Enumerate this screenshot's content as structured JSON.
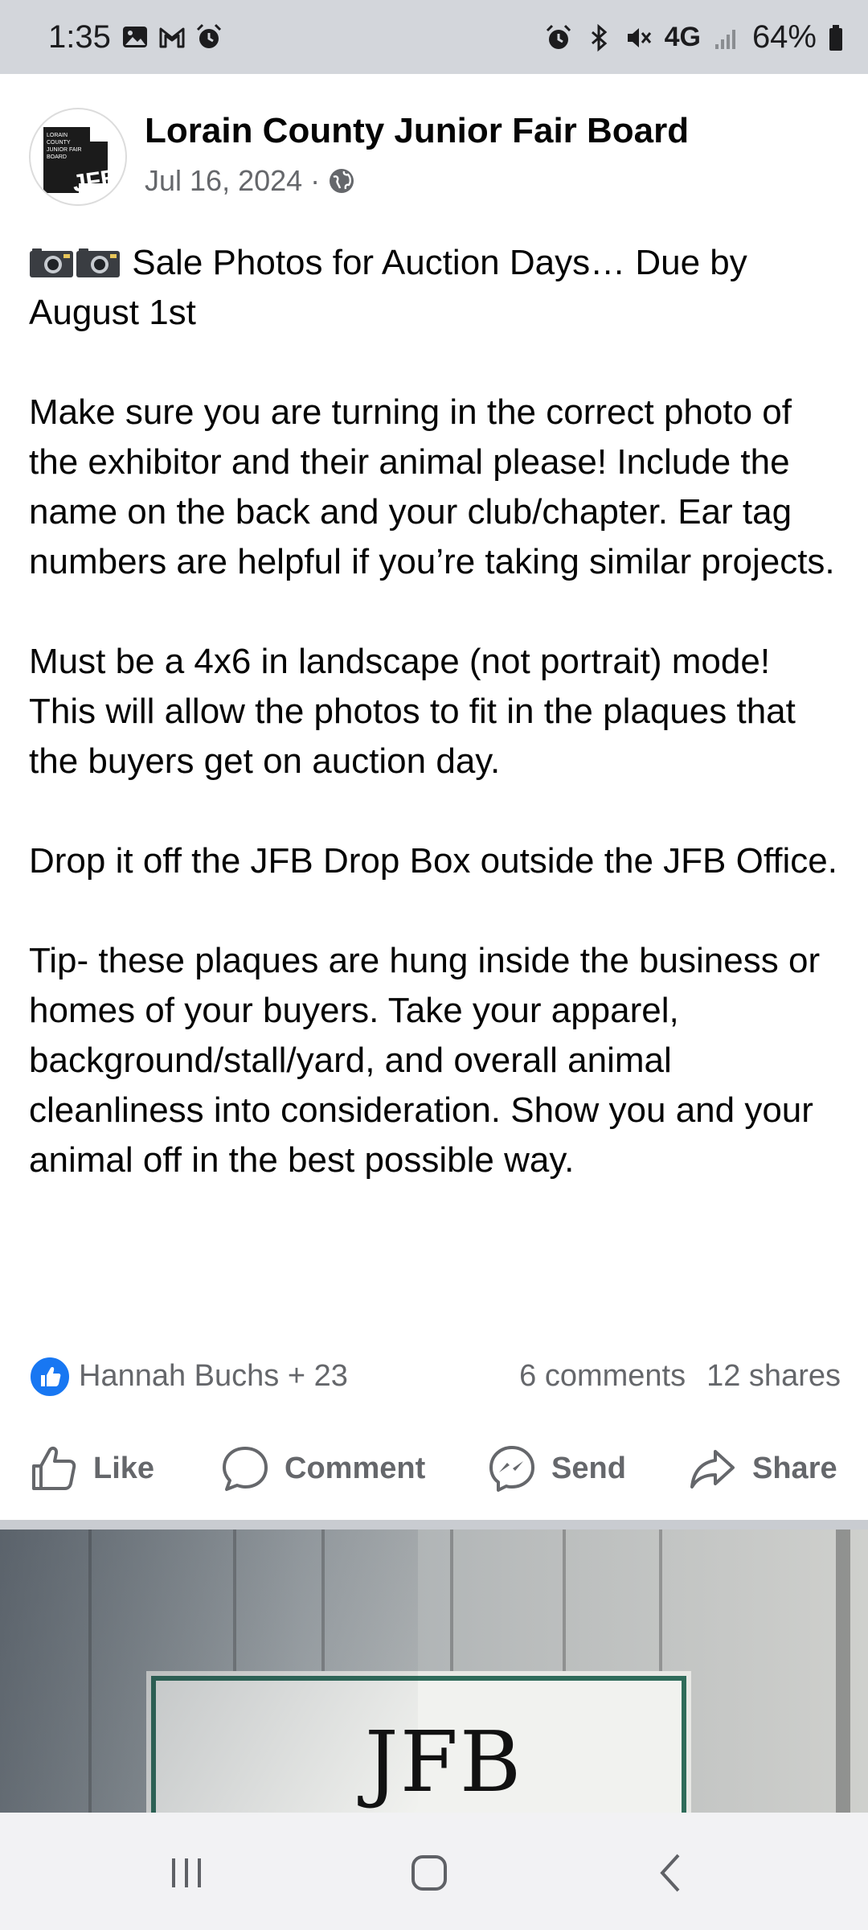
{
  "status_bar": {
    "time": "1:35",
    "network": "4G",
    "battery": "64%"
  },
  "post": {
    "page_name": "Lorain County Junior Fair Board",
    "avatar_logo": {
      "small_text": [
        "LORAIN",
        "COUNTY",
        "JUNIOR FAIR",
        "BOARD"
      ],
      "monogram": "JFB"
    },
    "date": "Jul 16, 2024",
    "separator": "·",
    "audience_icon": "globe-icon",
    "paragraphs": [
      "Sale Photos for Auction Days… Due by August 1st",
      "Make sure you are turning in the correct photo of the exhibitor and their animal please! Include the name on the back and your club/chapter. Ear tag numbers are helpful if you’re taking similar projects.",
      "Must be a 4x6 in landscape (not portrait) mode! This will allow the photos to fit in the plaques that the buyers get on auction day.",
      "Drop it off the JFB Drop Box outside the JFB Office.",
      "Tip- these plaques are hung inside the business or homes of your buyers. Take your apparel, background/stall/yard, and overall animal cleanliness into consideration. Show you and your animal off in the best possible way."
    ],
    "reactions": {
      "reactors": "Hannah Buchs + 23",
      "comments": "6 comments",
      "shares": "12 shares"
    },
    "actions": {
      "like": "Like",
      "comment": "Comment",
      "send": "Send",
      "share": "Share"
    }
  },
  "photo": {
    "sign_text": "JFB"
  },
  "colors": {
    "facebook_blue": "#1877f2",
    "secondary_text": "#65676b"
  }
}
